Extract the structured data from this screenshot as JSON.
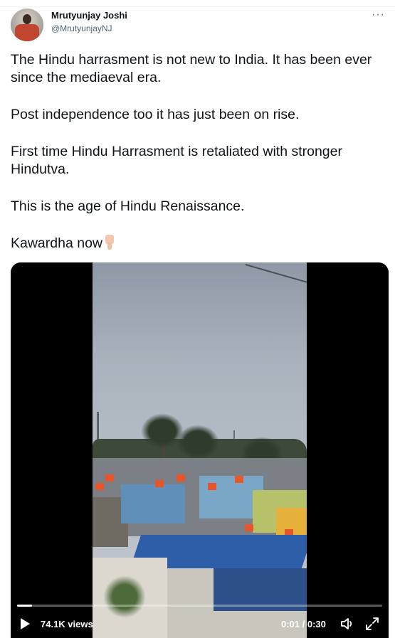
{
  "tweet": {
    "author_name": "Mrutyunjay Joshi",
    "author_handle": "@MrutyunjayNJ",
    "more_label": "···",
    "paragraphs": [
      "The Hindu harrasment is not new to India. It has been ever since the mediaeval era.",
      "Post independence too it has just been on rise.",
      "First time Hindu Harrasment is retaliated with stronger Hindutva.",
      "This is the age of Hindu Renaissance.",
      "Kawardha now"
    ],
    "emoji": "pointing-down-emoji"
  },
  "video": {
    "views": "74.1K views",
    "time": "0:01 / 0:30",
    "progress": 0.04,
    "icons": {
      "play": "play-icon",
      "volume": "volume-icon",
      "fullscreen": "fullscreen-icon"
    }
  }
}
